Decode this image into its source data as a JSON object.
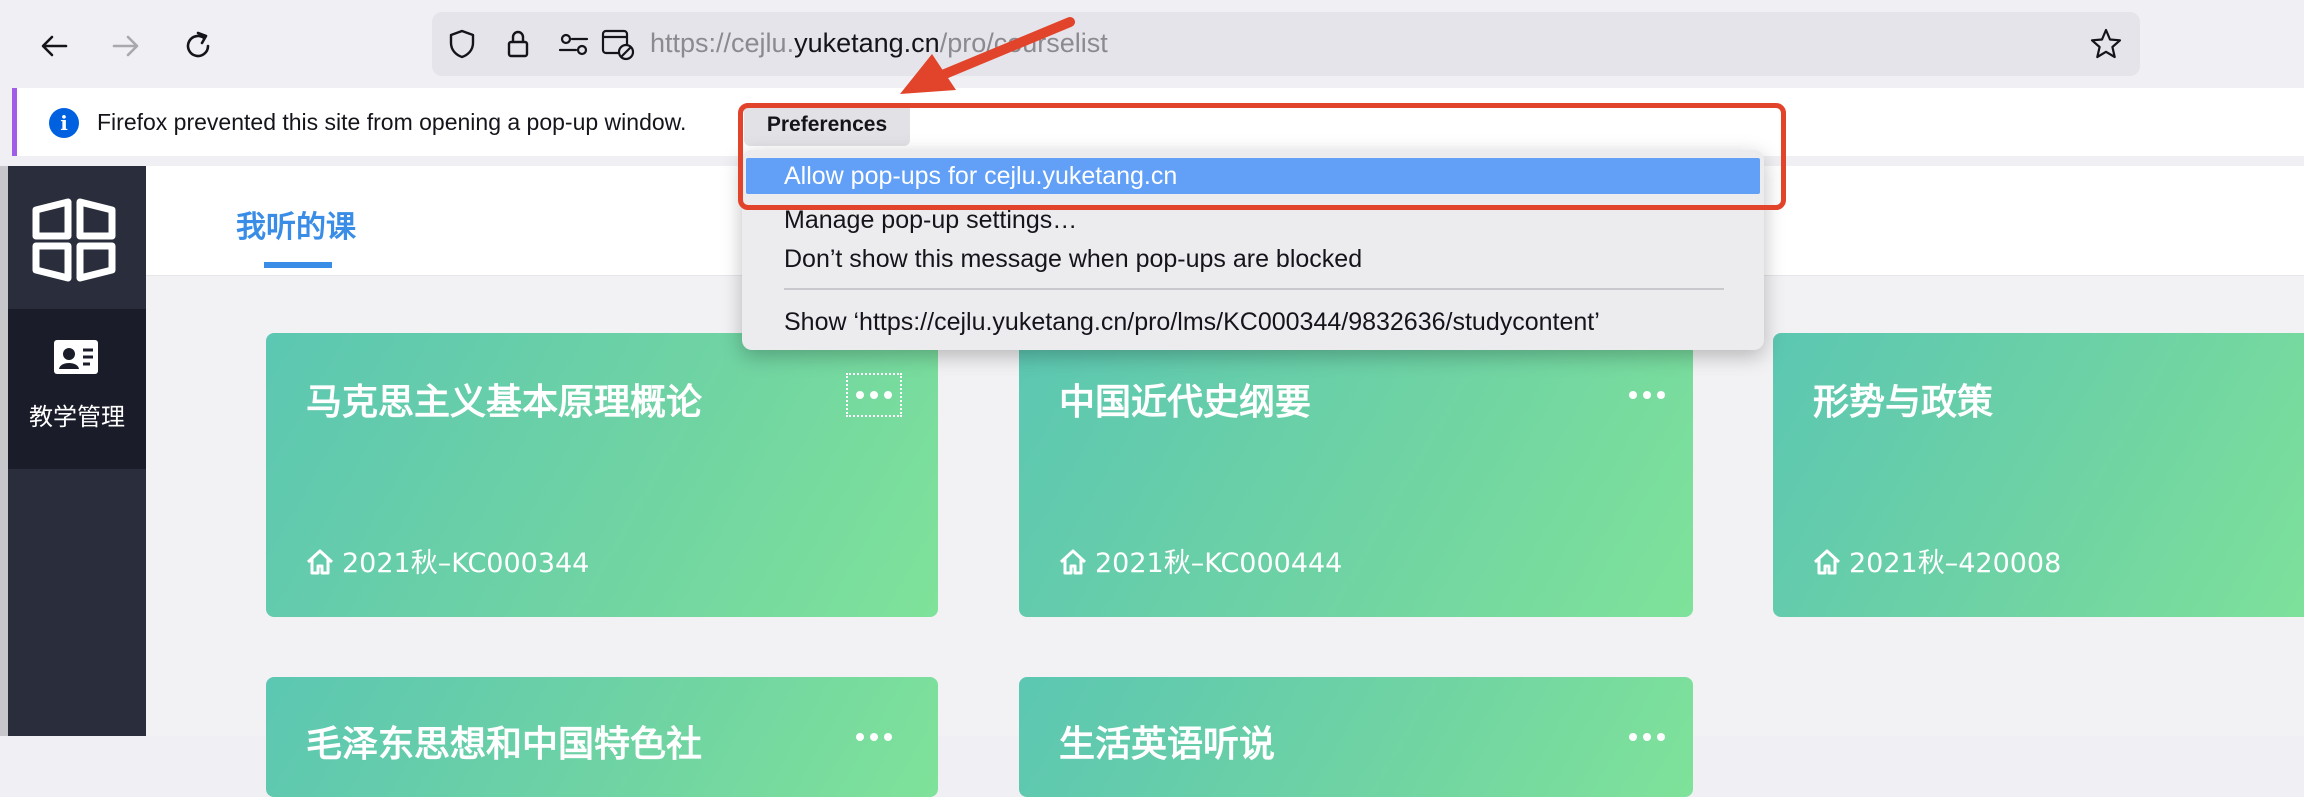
{
  "browser": {
    "url_prefix": "https://cejlu.",
    "url_host": "yuketang.cn",
    "url_path": "/pro/courselist"
  },
  "notification": {
    "message": "Firefox prevented this site from opening a pop-up window.",
    "preferences_label": "Preferences"
  },
  "popup_menu": {
    "allow": "Allow pop-ups for cejlu.yuketang.cn",
    "manage": "Manage pop-up settings…",
    "dont_show": "Don’t show this message when pop-ups are blocked",
    "show_url": "Show ‘https://cejlu.yuketang.cn/pro/lms/KC000344/9832636/studycontent’"
  },
  "sidebar": {
    "item_label": "教学管理"
  },
  "header": {
    "active_tab": "我听的课"
  },
  "courses": [
    {
      "title": "马克思主义基本原理概论",
      "code": "2021秋–KC000344"
    },
    {
      "title": "中国近代史纲要",
      "code": "2021秋–KC000444"
    },
    {
      "title": "形势与政策",
      "code": "2021秋–420008"
    },
    {
      "title": "毛泽东思想和中国特色社",
      "code": ""
    },
    {
      "title": "生活英语听说",
      "code": ""
    }
  ],
  "colors": {
    "accent": "#3a8de6",
    "menu_highlight": "#62a0f7",
    "annotation": "#e2442b",
    "sidebar": "#2a2e3c"
  }
}
